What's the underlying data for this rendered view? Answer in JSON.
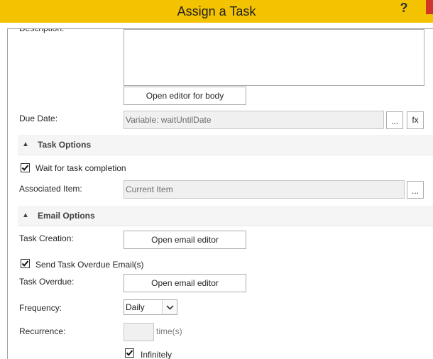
{
  "window": {
    "title": "Assign a Task",
    "help_label": "?"
  },
  "description": {
    "label": "Description:",
    "open_editor_label": "Open editor for body"
  },
  "due_date": {
    "label": "Due Date:",
    "value": "Variable: waitUntilDate",
    "browse_label": "...",
    "fx_label": "fx"
  },
  "task_options": {
    "header": "Task Options",
    "wait_checkbox_label": "Wait for task completion",
    "wait_checked": true,
    "associated_item_label": "Associated Item:",
    "associated_item_value": "Current Item",
    "browse_label": "..."
  },
  "email_options": {
    "header": "Email Options",
    "task_creation_label": "Task Creation:",
    "task_creation_button": "Open email editor",
    "overdue_checkbox_label": "Send Task Overdue Email(s)",
    "overdue_checked": true,
    "task_overdue_label": "Task Overdue:",
    "task_overdue_button": "Open email editor",
    "frequency_label": "Frequency:",
    "frequency_value": "Daily",
    "recurrence_label": "Recurrence:",
    "recurrence_value": "",
    "recurrence_unit": "time(s)",
    "infinitely_label": "Infinitely",
    "infinitely_checked": true
  }
}
